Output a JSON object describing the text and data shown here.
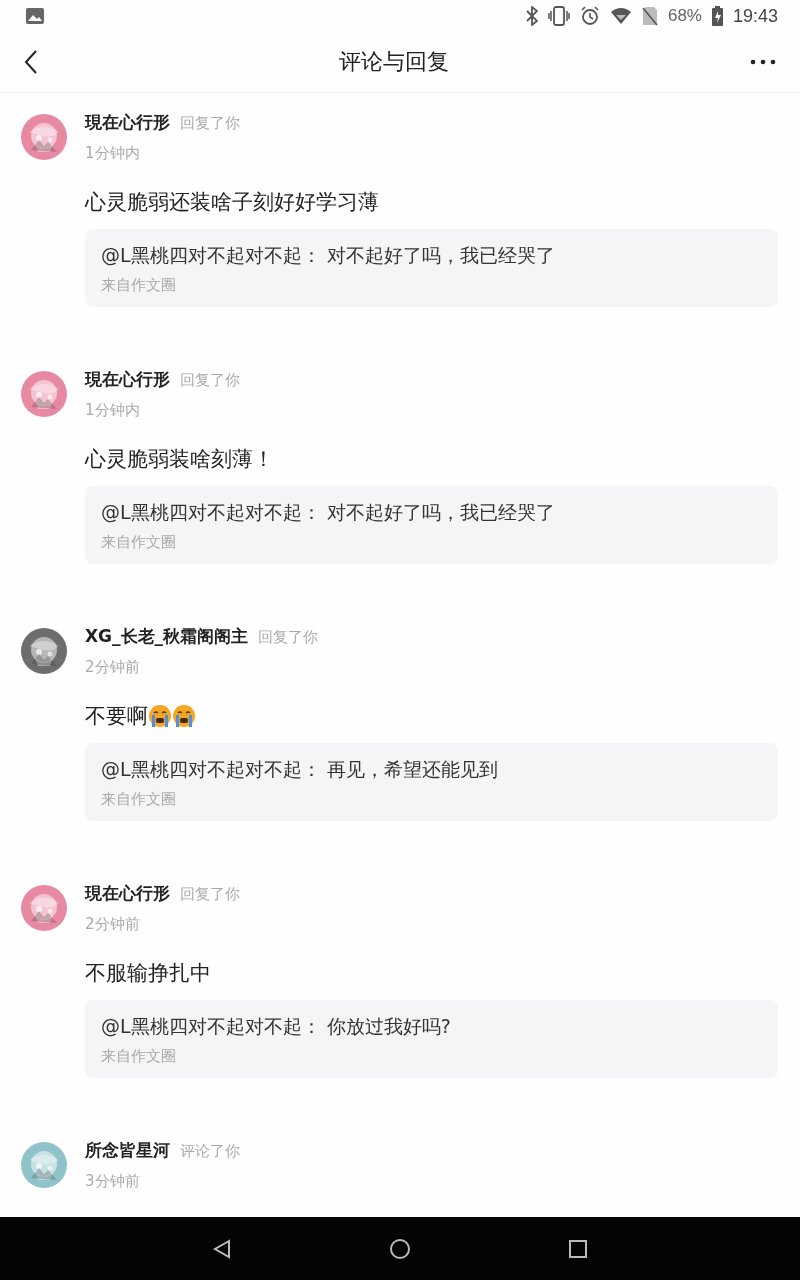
{
  "status_bar": {
    "battery_text": "68%",
    "time": "19:43"
  },
  "header": {
    "title": "评论与回复"
  },
  "comments": [
    {
      "name": "現在心行形",
      "action": "回复了你",
      "time": "1分钟内",
      "body": "心灵脆弱还装啥子刻好好学习薄",
      "quote": {
        "text": "@L黑桃四对不起对不起： 对不起好了吗，我已经哭了",
        "source": "来自作文圈"
      }
    },
    {
      "name": "現在心行形",
      "action": "回复了你",
      "time": "1分钟内",
      "body": "心灵脆弱装啥刻薄！",
      "quote": {
        "text": "@L黑桃四对不起对不起： 对不起好了吗，我已经哭了",
        "source": "来自作文圈"
      }
    },
    {
      "name": "XG_长老_秋霜阁阁主",
      "action": "回复了你",
      "time": "2分钟前",
      "body": "不要啊",
      "emojis": [
        {
          "kind": "crying"
        },
        {
          "kind": "crying"
        }
      ],
      "quote": {
        "text": "@L黑桃四对不起对不起： 再见，希望还能见到",
        "source": "来自作文圈"
      }
    },
    {
      "name": "現在心行形",
      "action": "回复了你",
      "time": "2分钟前",
      "body": "不服输挣扎中",
      "quote": {
        "text": "@L黑桃四对不起对不起： 你放过我好吗?",
        "source": "来自作文圈"
      }
    },
    {
      "name": "所念皆星河",
      "action": "评论了你",
      "time": "3分钟前"
    }
  ]
}
